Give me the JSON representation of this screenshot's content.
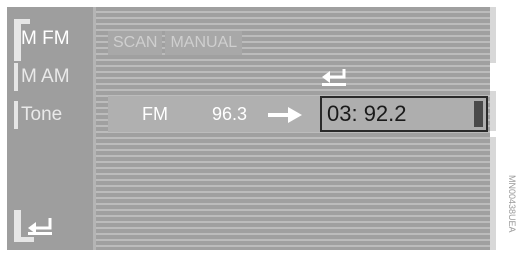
{
  "left_menu": {
    "items": [
      {
        "label": "M FM",
        "active": true
      },
      {
        "label": "M AM",
        "active": false
      },
      {
        "label": "Tone",
        "active": false
      }
    ],
    "back_icon": "return-arrow-icon"
  },
  "tabs": [
    "SCAN",
    "MANUAL"
  ],
  "station": {
    "band": "FM",
    "frequency": "96.3",
    "arrow_icon": "arrow-right-icon"
  },
  "preset": {
    "value": "03: 92.2"
  },
  "back_icon": "return-arrow-icon",
  "watermark": "MN00438UEA",
  "colors": {
    "background": "#9a9a9a",
    "text": "#ffffff",
    "selection_border": "#2a2a2a"
  }
}
